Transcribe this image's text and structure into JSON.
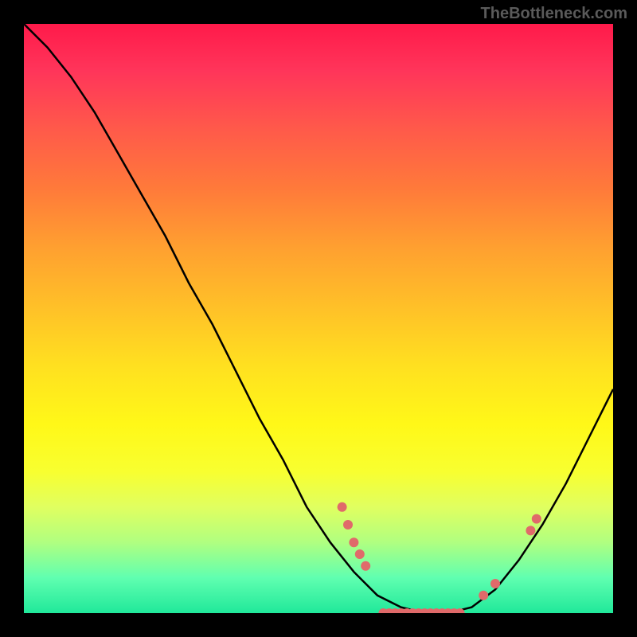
{
  "attribution": "TheBottleneck.com",
  "chart_data": {
    "type": "line",
    "title": "",
    "xlabel": "",
    "ylabel": "",
    "x_range": [
      0,
      100
    ],
    "y_range": [
      0,
      100
    ],
    "curve": [
      {
        "x": 0,
        "y": 100
      },
      {
        "x": 4,
        "y": 96
      },
      {
        "x": 8,
        "y": 91
      },
      {
        "x": 12,
        "y": 85
      },
      {
        "x": 16,
        "y": 78
      },
      {
        "x": 20,
        "y": 71
      },
      {
        "x": 24,
        "y": 64
      },
      {
        "x": 28,
        "y": 56
      },
      {
        "x": 32,
        "y": 49
      },
      {
        "x": 36,
        "y": 41
      },
      {
        "x": 40,
        "y": 33
      },
      {
        "x": 44,
        "y": 26
      },
      {
        "x": 48,
        "y": 18
      },
      {
        "x": 52,
        "y": 12
      },
      {
        "x": 56,
        "y": 7
      },
      {
        "x": 60,
        "y": 3
      },
      {
        "x": 64,
        "y": 1
      },
      {
        "x": 68,
        "y": 0
      },
      {
        "x": 72,
        "y": 0
      },
      {
        "x": 76,
        "y": 1
      },
      {
        "x": 80,
        "y": 4
      },
      {
        "x": 84,
        "y": 9
      },
      {
        "x": 88,
        "y": 15
      },
      {
        "x": 92,
        "y": 22
      },
      {
        "x": 96,
        "y": 30
      },
      {
        "x": 100,
        "y": 38
      }
    ],
    "markers": [
      {
        "x": 54,
        "y": 18
      },
      {
        "x": 55,
        "y": 15
      },
      {
        "x": 56,
        "y": 12
      },
      {
        "x": 57,
        "y": 10
      },
      {
        "x": 58,
        "y": 8
      },
      {
        "x": 61,
        "y": 0
      },
      {
        "x": 62,
        "y": 0
      },
      {
        "x": 63,
        "y": 0
      },
      {
        "x": 64,
        "y": 0
      },
      {
        "x": 65,
        "y": 0
      },
      {
        "x": 66,
        "y": 0
      },
      {
        "x": 67,
        "y": 0
      },
      {
        "x": 68,
        "y": 0
      },
      {
        "x": 69,
        "y": 0
      },
      {
        "x": 70,
        "y": 0
      },
      {
        "x": 71,
        "y": 0
      },
      {
        "x": 72,
        "y": 0
      },
      {
        "x": 73,
        "y": 0
      },
      {
        "x": 74,
        "y": 0
      },
      {
        "x": 78,
        "y": 3
      },
      {
        "x": 80,
        "y": 5
      },
      {
        "x": 86,
        "y": 14
      },
      {
        "x": 87,
        "y": 16
      }
    ],
    "colors": {
      "curve": "#000000",
      "marker": "#e06a6a",
      "gradient_top": "#ff1a4a",
      "gradient_bottom": "#20e89a"
    }
  }
}
